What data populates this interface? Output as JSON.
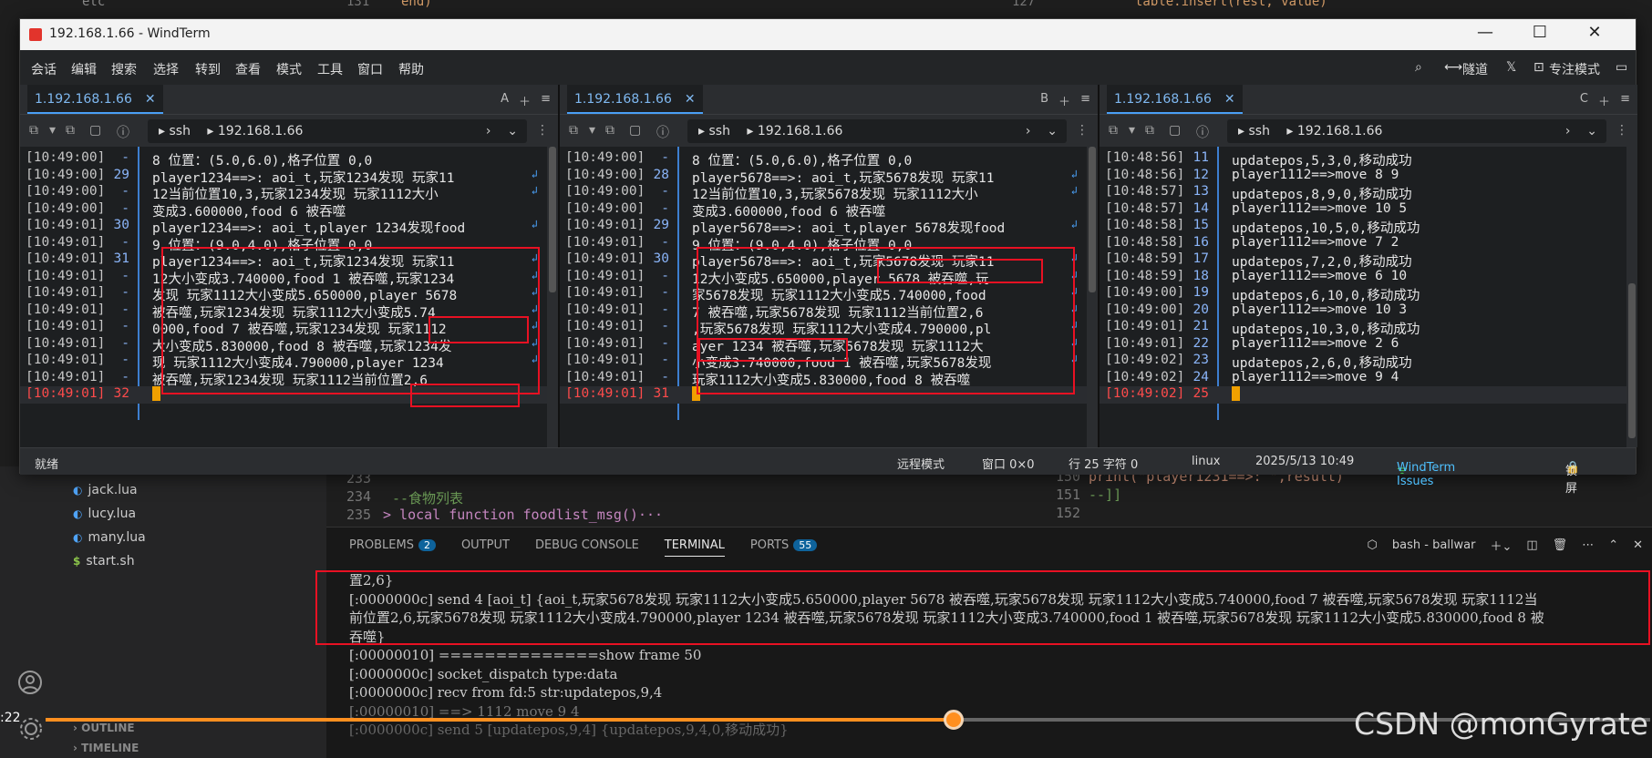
{
  "vscode": {
    "top_code_left": {
      "line_no": "131",
      "code": "end)"
    },
    "top_code_right": {
      "line_no": "127",
      "code": "table.insert(rest, value)"
    },
    "top_left_label": "etc",
    "sidebar_files": [
      "jack.lua",
      "lucy.lua",
      "many.lua",
      "start.sh"
    ],
    "sidebar_sections": [
      "OUTLINE",
      "TIMELINE"
    ],
    "editor_left": [
      {
        "no": "233",
        "code": ""
      },
      {
        "no": "234",
        "code": "--食物列表"
      },
      {
        "no": "235",
        "code": "> local function foodlist_msg()···"
      }
    ],
    "editor_right": [
      {
        "no": "150",
        "code": "    print(\"player1231==>: \",result)"
      },
      {
        "no": "151",
        "code": "--]]"
      },
      {
        "no": "152",
        "code": ""
      }
    ],
    "panel_tabs": [
      {
        "label": "PROBLEMS",
        "badge": "2"
      },
      {
        "label": "OUTPUT",
        "badge": ""
      },
      {
        "label": "DEBUG CONSOLE",
        "badge": ""
      },
      {
        "label": "TERMINAL",
        "badge": ""
      },
      {
        "label": "PORTS",
        "badge": "55"
      }
    ],
    "terminal_name": "bash - ballwar",
    "terminal_lines": [
      "置2,6}",
      "[:0000000c] send 4 [aoi_t] {aoi_t,玩家5678发现 玩家1112大小变成5.650000,player 5678 被吞噬,玩家5678发现 玩家1112大小变成5.740000,food 7 被吞噬,玩家5678发现 玩家1112当",
      "前位置2,6,玩家5678发现 玩家1112大小变成4.790000,player 1234 被吞噬,玩家5678发现 玩家1112大小变成3.740000,food 1 被吞噬,玩家5678发现 玩家1112大小变成5.830000,food 8 被",
      "吞噬}",
      "[:00000010] ==============show frame 50",
      "[:0000000c] socket_dispatch type:data",
      "[:0000000c] recv from fd:5 str:updatepos,9,4",
      "[:00000010] ==> 1112 move 9 4",
      "[:0000000c] send 5 [updatepos,9,4] {updatepos,9,4,0,移动成功}"
    ]
  },
  "video": {
    "time": ":22",
    "progress": 0.566,
    "watermark": "CSDN @monGyrate"
  },
  "windterm": {
    "title": "192.168.1.66 - WindTerm",
    "menu": [
      "会话",
      "编辑",
      "搜索",
      "选择",
      "转到",
      "查看",
      "模式",
      "工具",
      "窗口",
      "帮助"
    ],
    "menu_right": [
      "隧道",
      "专注模式"
    ],
    "status": {
      "left": "就绪",
      "mode": "远程模式",
      "window": "窗口 0×0",
      "pos": "行 25 字符 0",
      "os": "linux",
      "datetime": "2025/5/13 10:49",
      "issues": "WindTerm Issues",
      "lock": "锁屏"
    },
    "panes": [
      {
        "tab": "1.192.168.1.66",
        "letter": "A",
        "proto": "ssh",
        "host": "192.168.1.66",
        "lines": [
          {
            "ts": "[10:49:00]",
            "no": "-",
            "tx": "8 位置：(5.0,6.0),格子位置 0,0",
            "wrap": false
          },
          {
            "ts": "[10:49:00]",
            "no": "29",
            "tx": "player1234==>:  aoi_t,玩家1234发现 玩家11",
            "wrap": true
          },
          {
            "ts": "[10:49:00]",
            "no": "-",
            "tx": "12当前位置10,3,玩家1234发现 玩家1112大小",
            "wrap": true
          },
          {
            "ts": "[10:49:00]",
            "no": "-",
            "tx": "变成3.600000,food 6 被吞噬",
            "wrap": false
          },
          {
            "ts": "[10:49:01]",
            "no": "30",
            "tx": "player1234==>:  aoi_t,player 1234发现food",
            "wrap": true
          },
          {
            "ts": "[10:49:01]",
            "no": "-",
            "tx": "9 位置：(9.0,4.0),格子位置 0,0",
            "wrap": false
          },
          {
            "ts": "[10:49:01]",
            "no": "31",
            "tx": "player1234==>:  aoi_t,玩家1234发现 玩家11",
            "wrap": true
          },
          {
            "ts": "[10:49:01]",
            "no": "-",
            "tx": "12大小变成3.740000,food 1 被吞噬,玩家1234",
            "wrap": true
          },
          {
            "ts": "[10:49:01]",
            "no": "-",
            "tx": "发现 玩家1112大小变成5.650000,player 5678",
            "wrap": true
          },
          {
            "ts": "[10:49:01]",
            "no": "-",
            "tx": " 被吞噬,玩家1234发现 玩家1112大小变成5.74",
            "wrap": true
          },
          {
            "ts": "[10:49:01]",
            "no": "-",
            "tx": "0000,food 7 被吞噬,玩家1234发现 玩家1112",
            "wrap": true
          },
          {
            "ts": "[10:49:01]",
            "no": "-",
            "tx": "大小变成5.830000,food 8 被吞噬,玩家1234发",
            "wrap": true
          },
          {
            "ts": "[10:49:01]",
            "no": "-",
            "tx": "现 玩家1112大小变成4.790000,player 1234",
            "wrap": true
          },
          {
            "ts": "[10:49:01]",
            "no": "-",
            "tx": "被吞噬,玩家1234发现 玩家1112当前位置2,6",
            "wrap": false
          },
          {
            "ts": "[10:49:01]",
            "no": "32",
            "tx": "",
            "wrap": false
          }
        ]
      },
      {
        "tab": "1.192.168.1.66",
        "letter": "B",
        "proto": "ssh",
        "host": "192.168.1.66",
        "lines": [
          {
            "ts": "[10:49:00]",
            "no": "-",
            "tx": "8 位置：(5.0,6.0),格子位置 0,0",
            "wrap": false
          },
          {
            "ts": "[10:49:00]",
            "no": "28",
            "tx": "player5678==>:  aoi_t,玩家5678发现 玩家11",
            "wrap": true
          },
          {
            "ts": "[10:49:00]",
            "no": "-",
            "tx": "12当前位置10,3,玩家5678发现 玩家1112大小",
            "wrap": true
          },
          {
            "ts": "[10:49:00]",
            "no": "-",
            "tx": "变成3.600000,food 6 被吞噬",
            "wrap": false
          },
          {
            "ts": "[10:49:01]",
            "no": "29",
            "tx": "player5678==>:  aoi_t,player 5678发现food",
            "wrap": true
          },
          {
            "ts": "[10:49:01]",
            "no": "-",
            "tx": "9 位置：(9.0,4.0),格子位置 0,0",
            "wrap": false
          },
          {
            "ts": "[10:49:01]",
            "no": "30",
            "tx": "player5678==>:  aoi_t,玩家5678发现 玩家11",
            "wrap": true
          },
          {
            "ts": "[10:49:01]",
            "no": "-",
            "tx": "12大小变成5.650000,player 5678 被吞噬,玩",
            "wrap": true
          },
          {
            "ts": "[10:49:01]",
            "no": "-",
            "tx": "家5678发现 玩家1112大小变成5.740000,food",
            "wrap": true
          },
          {
            "ts": "[10:49:01]",
            "no": "-",
            "tx": "7 被吞噬,玩家5678发现 玩家1112当前位置2,6",
            "wrap": true
          },
          {
            "ts": "[10:49:01]",
            "no": "-",
            "tx": ",玩家5678发现 玩家1112大小变成4.790000,pl",
            "wrap": true
          },
          {
            "ts": "[10:49:01]",
            "no": "-",
            "tx": "ayer 1234 被吞噬,玩家5678发现 玩家1112大",
            "wrap": true
          },
          {
            "ts": "[10:49:01]",
            "no": "-",
            "tx": "小变成3.740000,food 1 被吞噬,玩家5678发现",
            "wrap": true
          },
          {
            "ts": "[10:49:01]",
            "no": "-",
            "tx": " 玩家1112大小变成5.830000,food 8 被吞噬",
            "wrap": false
          },
          {
            "ts": "[10:49:01]",
            "no": "31",
            "tx": "",
            "wrap": false
          }
        ]
      },
      {
        "tab": "1.192.168.1.66",
        "letter": "C",
        "proto": "ssh",
        "host": "192.168.1.66",
        "lines": [
          {
            "ts": "[10:48:56]",
            "no": "11",
            "tx": "updatepos,5,3,0,移动成功",
            "wrap": false
          },
          {
            "ts": "[10:48:56]",
            "no": "12",
            "tx": "player1112==>move        8       9",
            "wrap": false
          },
          {
            "ts": "[10:48:57]",
            "no": "13",
            "tx": "updatepos,8,9,0,移动成功",
            "wrap": false
          },
          {
            "ts": "[10:48:57]",
            "no": "14",
            "tx": "player1112==>move        10      5",
            "wrap": false
          },
          {
            "ts": "[10:48:58]",
            "no": "15",
            "tx": "updatepos,10,5,0,移动成功",
            "wrap": false
          },
          {
            "ts": "[10:48:58]",
            "no": "16",
            "tx": "player1112==>move        7       2",
            "wrap": false
          },
          {
            "ts": "[10:48:59]",
            "no": "17",
            "tx": "updatepos,7,2,0,移动成功",
            "wrap": false
          },
          {
            "ts": "[10:48:59]",
            "no": "18",
            "tx": "player1112==>move        6       10",
            "wrap": false
          },
          {
            "ts": "[10:49:00]",
            "no": "19",
            "tx": "updatepos,6,10,0,移动成功",
            "wrap": false
          },
          {
            "ts": "[10:49:00]",
            "no": "20",
            "tx": "player1112==>move        10      3",
            "wrap": false
          },
          {
            "ts": "[10:49:01]",
            "no": "21",
            "tx": "updatepos,10,3,0,移动成功",
            "wrap": false
          },
          {
            "ts": "[10:49:01]",
            "no": "22",
            "tx": "player1112==>move        2       6",
            "wrap": false
          },
          {
            "ts": "[10:49:02]",
            "no": "23",
            "tx": "updatepos,2,6,0,移动成功",
            "wrap": false
          },
          {
            "ts": "[10:49:02]",
            "no": "24",
            "tx": "player1112==>move        9       4",
            "wrap": false
          },
          {
            "ts": "[10:49:02]",
            "no": "25",
            "tx": "",
            "wrap": false
          }
        ]
      }
    ]
  }
}
